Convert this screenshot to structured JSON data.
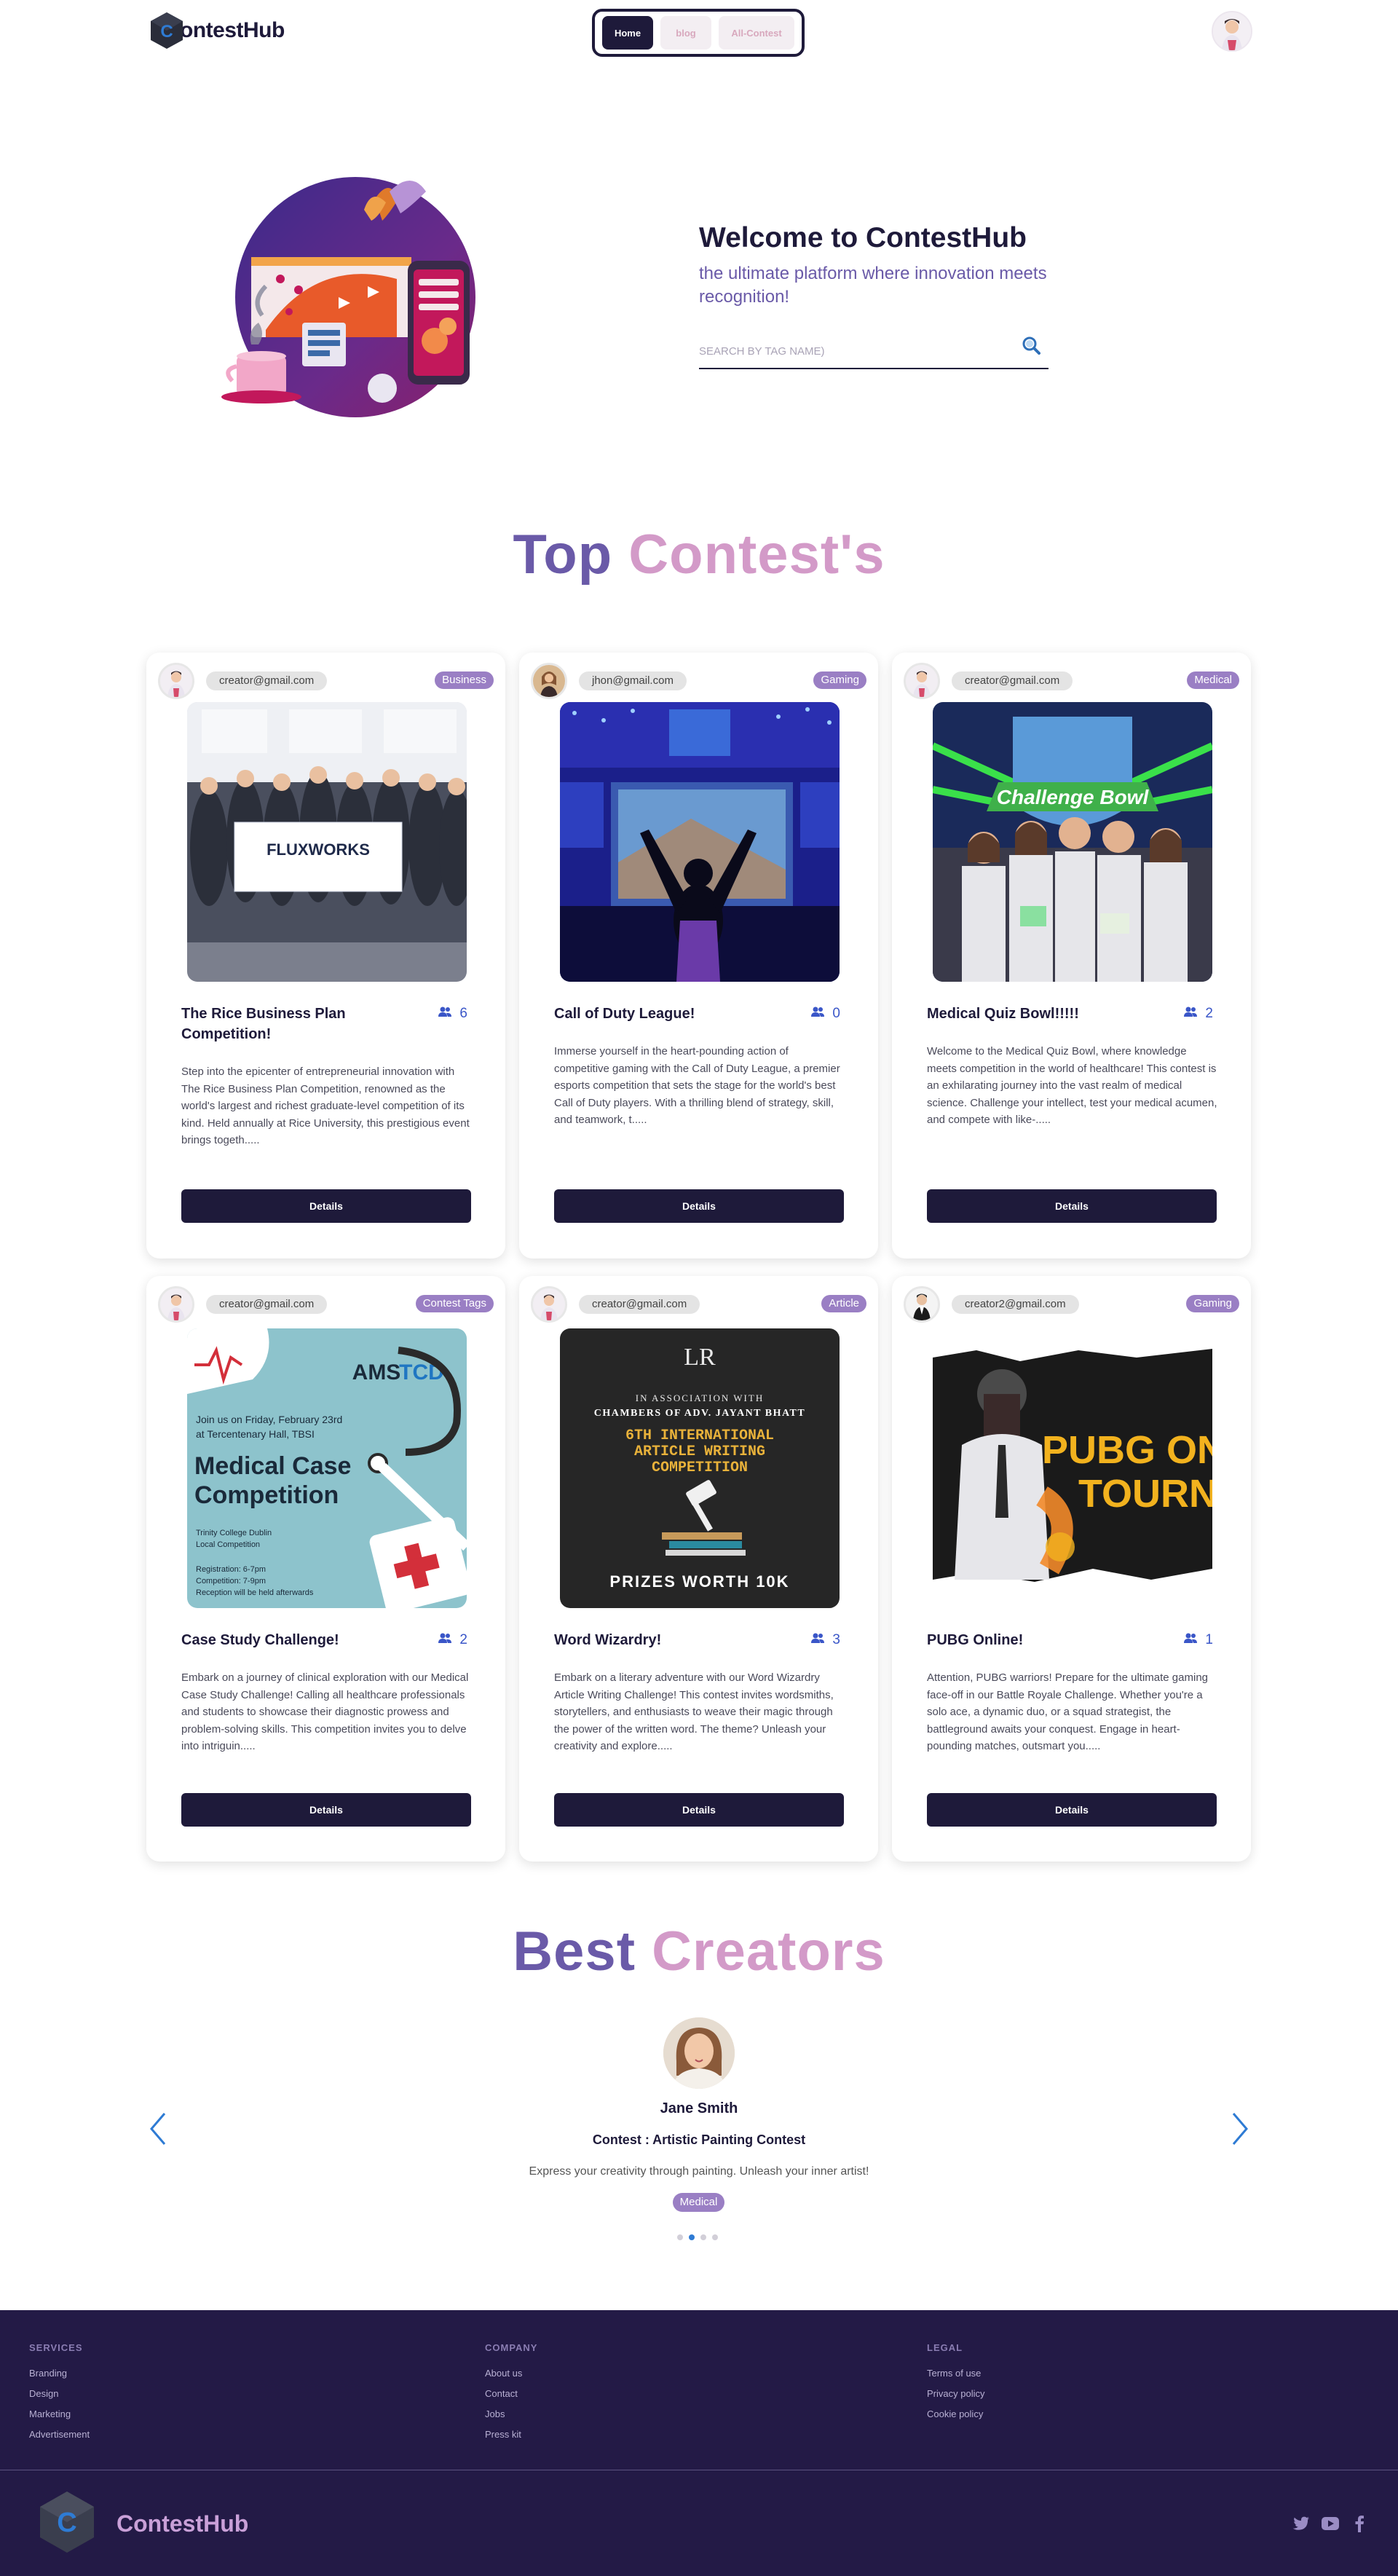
{
  "nav": {
    "brand": "ontestHub",
    "links": [
      "Home",
      "blog",
      "All-Contest"
    ]
  },
  "hero": {
    "title": "Welcome to ContestHub",
    "subtitle": "the ultimate platform where innovation meets recognition!",
    "search_placeholder": "SEARCH BY TAG NAME)"
  },
  "top_contests": {
    "title_part1": "Top",
    "title_part2": "Contest's",
    "details_label": "Details",
    "cards": [
      {
        "email": "creator@gmail.com",
        "tag": "Business",
        "title": "The Rice Business Plan Competition!",
        "participants": "6",
        "description": "Step into the epicenter of entrepreneurial innovation with The Rice Business Plan Competition, renowned as the world's largest and richest graduate-level competition of its kind. Held annually at Rice University, this prestigious event brings togeth.....",
        "image_text": "FLUXWORKS"
      },
      {
        "email": "jhon@gmail.com",
        "tag": "Gaming",
        "title": "Call of Duty League!",
        "participants": "0",
        "description": "Immerse yourself in the heart-pounding action of competitive gaming with the Call of Duty League, a premier esports competition that sets the stage for the world's best Call of Duty players. With a thrilling blend of strategy, skill, and teamwork, t.....",
        "image_text": ""
      },
      {
        "email": "creator@gmail.com",
        "tag": "Medical",
        "title": "Medical Quiz Bowl!!!!!",
        "participants": "2",
        "description": "Welcome to the Medical Quiz Bowl, where knowledge meets competition in the world of healthcare! This contest is an exhilarating journey into the vast realm of medical science. Challenge your intellect, test your medical acumen, and compete with like-.....",
        "image_text": "Challenge Bowl"
      },
      {
        "email": "creator@gmail.com",
        "tag": "Contest Tags",
        "title": "Case Study Challenge!",
        "participants": "2",
        "description": "Embark on a journey of clinical exploration with our Medical Case Study Challenge! Calling all healthcare professionals and students to showcase their diagnostic prowess and problem-solving skills. This competition invites you to delve into intriguin.....",
        "image_text": "Medical Case Competition"
      },
      {
        "email": "creator@gmail.com",
        "tag": "Article",
        "title": "Word Wizardry!",
        "participants": "3",
        "description": "Embark on a literary adventure with our Word Wizardry Article Writing Challenge! This contest invites wordsmiths, storytellers, and enthusiasts to weave their magic through the power of the written word. The theme? Unleash your creativity and explore.....",
        "image_text": "PRIZES WORTH 10K"
      },
      {
        "email": "creator2@gmail.com",
        "tag": "Gaming",
        "title": "PUBG Online!",
        "participants": "1",
        "description": "Attention, PUBG warriors! Prepare for the ultimate gaming face-off in our Battle Royale Challenge. Whether you're a solo ace, a dynamic duo, or a squad strategist, the battleground awaits your conquest. Engage in heart-pounding matches, outsmart you.....",
        "image_text": "PUBG ONLINE TOURNA"
      }
    ]
  },
  "creators": {
    "title_part1": "Best",
    "title_part2": "Creators",
    "name": "Jane Smith",
    "contest": "Contest : Artistic Painting Contest",
    "description": "Express your creativity through painting. Unleash your inner artist!",
    "tag": "Medical"
  },
  "footer": {
    "services_head": "SERVICES",
    "services": [
      "Branding",
      "Design",
      "Marketing",
      "Advertisement"
    ],
    "company_head": "COMPANY",
    "company": [
      "About us",
      "Contact",
      "Jobs",
      "Press kit"
    ],
    "legal_head": "LEGAL",
    "legal": [
      "Terms of use",
      "Privacy policy",
      "Cookie policy"
    ],
    "brand": "ContestHub"
  },
  "colors": {
    "navy": "#1e1a3a",
    "purple": "#6a5aa8",
    "pink": "#d39ac8",
    "tag": "#9a7fc4",
    "footer": "#231a46",
    "accent_blue": "#2e7bd4"
  }
}
